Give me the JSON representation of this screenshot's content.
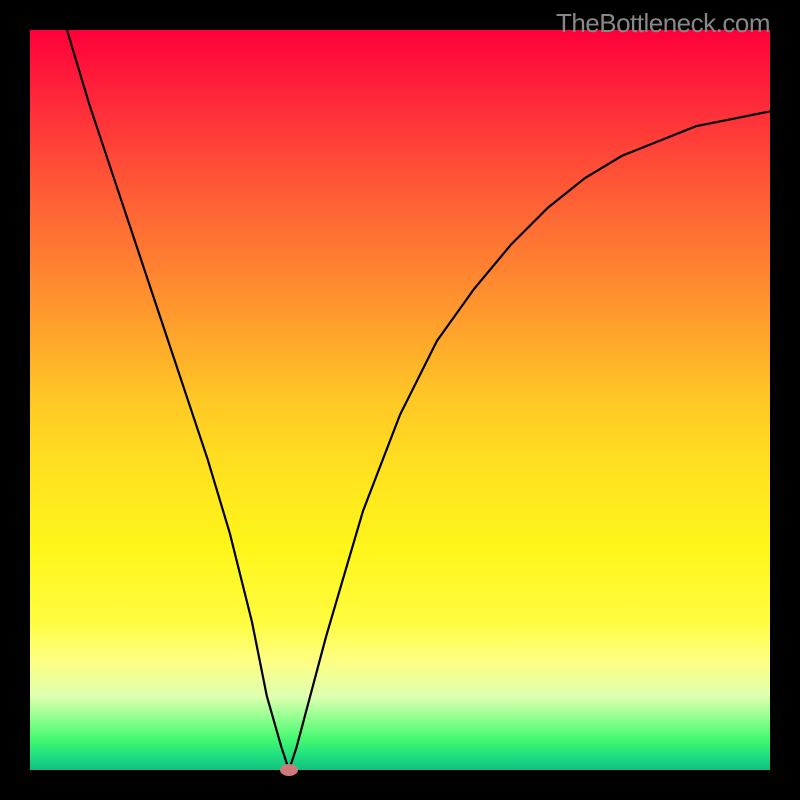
{
  "attribution": "TheBottleneck.com",
  "chart_data": {
    "type": "line",
    "title": "",
    "xlabel": "",
    "ylabel": "",
    "xlim": [
      0,
      100
    ],
    "ylim": [
      0,
      100
    ],
    "grid": false,
    "background_gradient": {
      "direction": "vertical",
      "stops": [
        {
          "pos": 0,
          "color": "#ff003a"
        },
        {
          "pos": 50,
          "color": "#ffc825"
        },
        {
          "pos": 85,
          "color": "#ffff80"
        },
        {
          "pos": 100,
          "color": "#10c080"
        }
      ]
    },
    "series": [
      {
        "name": "bottleneck-curve",
        "color": "#000000",
        "x": [
          5,
          8,
          12,
          16,
          20,
          24,
          27,
          30,
          32,
          34,
          35,
          36,
          40,
          45,
          50,
          55,
          60,
          65,
          70,
          75,
          80,
          85,
          90,
          95,
          100
        ],
        "values": [
          100,
          90,
          78,
          66,
          54,
          42,
          32,
          20,
          10,
          3,
          0,
          3,
          18,
          35,
          48,
          58,
          65,
          71,
          76,
          80,
          83,
          85,
          87,
          88,
          89
        ]
      }
    ],
    "marker": {
      "x": 35,
      "y": 0,
      "color": "#cf7a7a"
    }
  }
}
